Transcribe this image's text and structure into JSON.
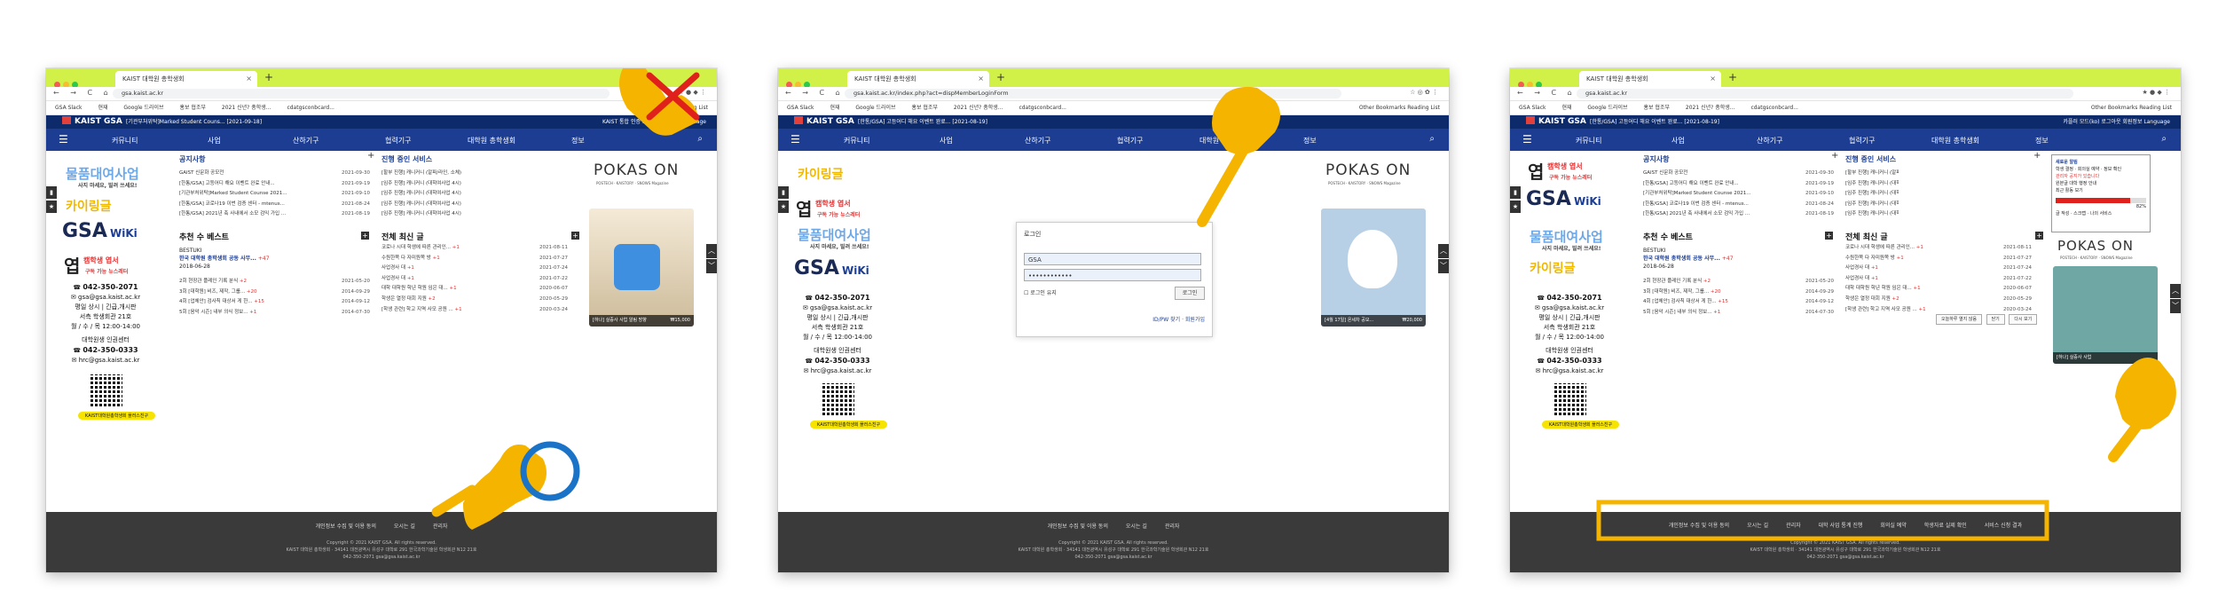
{
  "browser": {
    "tab_title": "KAIST 대학원 총학생회",
    "tab_close": "×",
    "new_tab": "+",
    "nav_buttons": "← → C ⌂",
    "extensions_1": "☆ ● ◆ ⋮",
    "extensions_2": "☆ ◎ ✿ ⋮",
    "extensions_3": "★ ● ◆ ⋮",
    "url_home": "gsa.kaist.ac.kr",
    "url_login": "gsa.kaist.ac.kr/index.php?act=dispMemberLoginForm",
    "bookmarks": [
      "GSA Slack",
      "현재",
      "Google 드라이브",
      "홍보 협조부",
      "2021 신년? 총학생...",
      "cdatgsconbcard..."
    ],
    "bookmarks_right": "Other Bookmarks   Reading List",
    "colors": {
      "tabbar": "#d1f048",
      "navbar": "#1c3d91",
      "infobar": "#0d2a6b",
      "highlight": "#f5b400",
      "error": "#e0201a",
      "circle": "#1a73c7"
    }
  },
  "site": {
    "logo": "KAIST GSA",
    "notice_1": "[기관부처위탁]Marked Student Couns... [2021-09-18]",
    "notice_2": "[한통/GSA] 고등어디 해요 이벤트 완료... [2021-08-19]",
    "info_right": "KAIST 통합 인증 로그인   회원가입   Language",
    "info_right_logged": "카플러 모드(ko)   로그아웃   회원정보   Language",
    "nav": [
      "커뮤니티",
      "사업",
      "산하기구",
      "협력기구",
      "대학원 총학생회",
      "정보"
    ],
    "promos": {
      "rent": "물품대여사업",
      "rent_sub": "사지 마세요, 빌려 쓰세요!",
      "cai": "카이링글",
      "gsa": "GSA",
      "wiki": "WiKi",
      "ub": "엽",
      "ub_brand": "캠학생 엽서",
      "ub_sub": "구독 가능 뉴스레터"
    },
    "contact": {
      "phone": "042-350-2071",
      "email": "gsa@gsa.kaist.ac.kr",
      "hours": "평일 상시 | 긴급,개시판",
      "office_label": "서측 학생회관 21호",
      "office_time": "월 / 수 / 목 12:00-14:00",
      "center": "대학원생 인권센터",
      "center_phone": "042-350-0333",
      "center_email": "hrc@gsa.kaist.ac.kr",
      "kakao": "KAIST대학원총학생회 플러스친구"
    },
    "notices": {
      "title": "공지사항",
      "rows": [
        {
          "t": "GAIST 신문화 공모전",
          "d": "2021-09-30"
        },
        {
          "t": "[한통/GSA] 고등어디 해요 이벤트 완료 안내...",
          "d": "2021-09-19"
        },
        {
          "t": "[기관부처위탁]Marked Student Counse 2021...",
          "d": "2021-09-10"
        },
        {
          "t": "[한통/GSA] 코로나19 이번 검증 센터 - mtenus...",
          "d": "2021-08-24"
        },
        {
          "t": "[한통/GSA] 2021년 축 사내에서 소모 검익 가입 ...",
          "d": "2021-08-19"
        }
      ]
    },
    "services": {
      "title": "진행 중인 서비스",
      "rows": [
        "[할부 진행] 캐니커니 (알파/라인, 소체)",
        "[임주 진행] 캐니커니 (대학여사업 4시)",
        "[임주 진행] 캐니커니 (대학여사업 4시)",
        "[임주 진행] 캐니커니 (대학여사업 4시)",
        "[임주 진행] 캐니커니 (대학여사업 4시)"
      ]
    },
    "best": {
      "title": "추천 수 베스트",
      "author": "BESTUKI",
      "post": "한국 대학원 총학생회 공동 사무...",
      "post_count": "+47",
      "post_date": "2018-06-28",
      "rows": [
        {
          "t": "2회 현장관 플레인 기록 분식",
          "c": "+2",
          "d": "2021-05-20"
        },
        {
          "t": "3회 [대학원] 비즈, 제작, 그룹...",
          "c": "+20",
          "d": "2014-09-29"
        },
        {
          "t": "4회 [업체안] 검사칙 대상서 게 한...",
          "c": "+15",
          "d": "2014-09-12"
        },
        {
          "t": "5회 [음악 시즌] 내부 의식 정보...",
          "c": "+1",
          "d": "2014-07-30"
        }
      ]
    },
    "latest": {
      "title": "전체 최신 글",
      "rows": [
        {
          "t": "코로나 시대 학생에 따른 관리인...",
          "c": "+1",
          "d": "2021-08-11"
        },
        {
          "t": "수원한쪽 다 자미원쪽 방",
          "c": "+1",
          "d": "2021-07-27"
        },
        {
          "t": "사업경사 대",
          "c": "+1",
          "d": "2021-07-24"
        },
        {
          "t": "사업경사 대",
          "c": "+1",
          "d": "2021-07-22"
        },
        {
          "t": "대학 대학원 학년 학원 임은 대...",
          "c": "+1",
          "d": "2020-06-07"
        },
        {
          "t": "학생은 열정 대회 지원",
          "c": "+2",
          "d": "2020-05-29"
        },
        {
          "t": "[학생 관련] 학고 지역 사모 공원 ...",
          "c": "+1",
          "d": "2020-03-24"
        }
      ]
    },
    "pokas": "POKAS ON",
    "pokas_sub": "POSTECH · KAISTORY · SNOWS Magazine",
    "ad_caption_1": "[하나] 실증사 사업 알림 방향",
    "ad_price_1": "₩15,000",
    "ad_caption_2": "[4월 17일] 온세차 공모...",
    "ad_price_2": "₩20,000",
    "ad_caption_3": "[하나] 실증사 사업",
    "footer": {
      "links": [
        "개인정보 수집 및 이용 동의",
        "오시는 길",
        "관리자"
      ],
      "links_full": [
        "개인정보 수집 및 이용 동의",
        "오시는 길",
        "관리자",
        "대학 사업 통계 진행",
        "회의실 예약",
        "학생자료 실제 확인",
        "서비스 신청 결과"
      ],
      "copyright": "Copyright © 2021 KAIST GSA. All rights reserved.",
      "address": "KAIST 대학원 총학생회 · 34141 대전광역시 유성구 대학로 291 한국과학기술원 학생회관 N12 21호",
      "phone": "042-350-2071  gsa@gsa.kaist.ac.kr"
    },
    "login": {
      "title": "로그인",
      "user": "GSA",
      "pass": "••••••••••••",
      "keep": "로그인 유지",
      "button": "로그인",
      "links": "ID/PW 찾기 · 회원가입"
    },
    "modal": {
      "header": "새로운 알림",
      "lines": [
        "학생 결정 · 회의실 예약 · 정보 확인",
        "관리자 공지가 있습니다",
        "원본글 대학 행정 안내",
        "최근 활동 보기"
      ],
      "stat_1": "82%",
      "actions": "글 작성   ·   스크랩   ·   나의 서비스"
    },
    "popup_buttons": [
      "오늘하루 열지 않음",
      "닫기",
      "다시 보기"
    ]
  }
}
